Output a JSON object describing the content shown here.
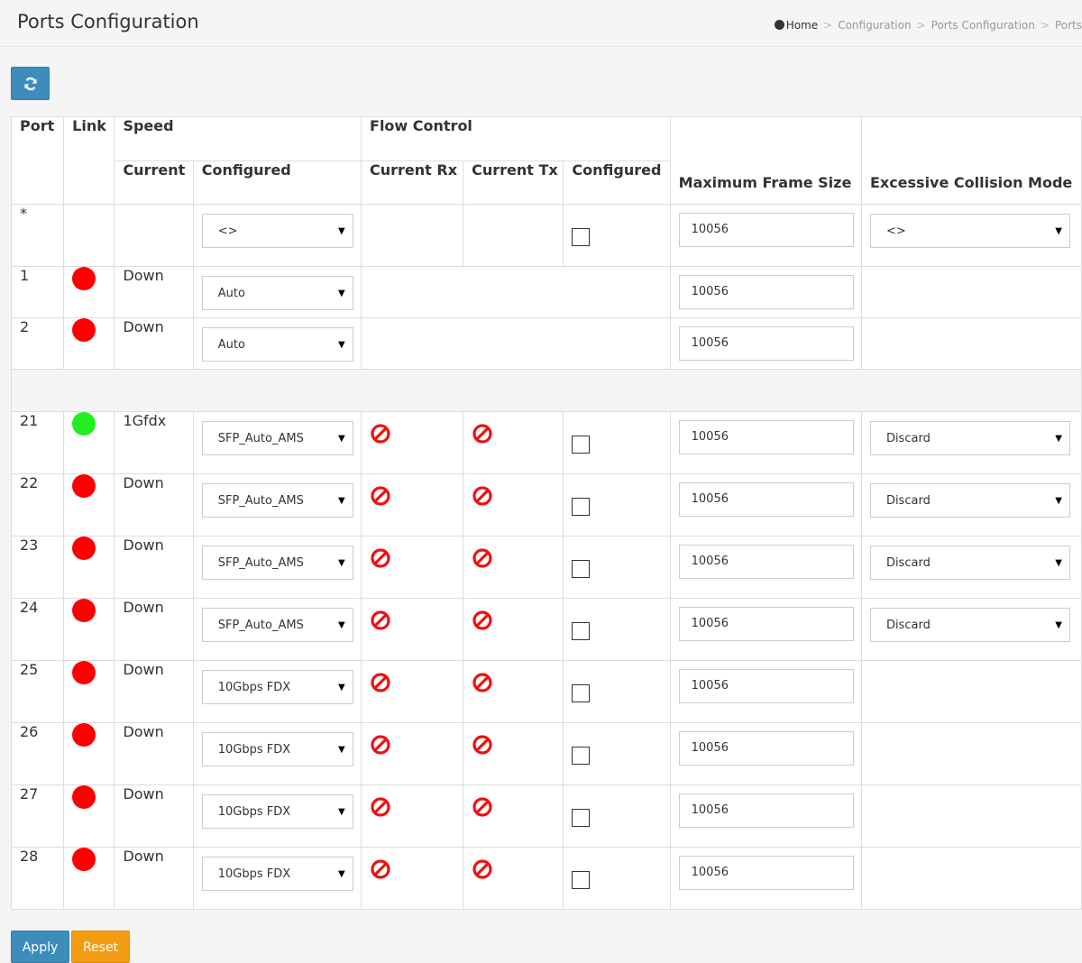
{
  "page": {
    "title": "Ports Configuration"
  },
  "breadcrumb": {
    "home": "Home",
    "items": [
      "Configuration",
      "Ports Configuration",
      "Ports"
    ],
    "separator": ">"
  },
  "toolbar": {
    "refresh_icon": "refresh-icon"
  },
  "table": {
    "headers": {
      "port": "Port",
      "link": "Link",
      "speed_group": "Speed",
      "speed_current": "Current",
      "speed_configured": "Configured",
      "flow_group": "Flow Control",
      "flow_current_rx": "Current Rx",
      "flow_current_tx": "Current Tx",
      "flow_configured": "Configured",
      "max_frame": "Maximum Frame Size",
      "ecm": "Excessive Collision Mode"
    },
    "star_row": {
      "port": "*",
      "speed_configured": "<>",
      "max_frame": "10056",
      "ecm": "<>"
    },
    "rows": [
      {
        "port": "1",
        "link": "down",
        "current": "Down",
        "speed_configured": "Auto",
        "max_frame": "10056",
        "show_flow": false,
        "ecm": ""
      },
      {
        "port": "2",
        "link": "down",
        "current": "Down",
        "speed_configured": "Auto",
        "max_frame": "10056",
        "show_flow": false,
        "ecm": ""
      },
      {
        "port": "21",
        "link": "up",
        "current": "1Gfdx",
        "speed_configured": "SFP_Auto_AMS",
        "max_frame": "10056",
        "show_flow": true,
        "ecm": "Discard"
      },
      {
        "port": "22",
        "link": "down",
        "current": "Down",
        "speed_configured": "SFP_Auto_AMS",
        "max_frame": "10056",
        "show_flow": true,
        "ecm": "Discard"
      },
      {
        "port": "23",
        "link": "down",
        "current": "Down",
        "speed_configured": "SFP_Auto_AMS",
        "max_frame": "10056",
        "show_flow": true,
        "ecm": "Discard"
      },
      {
        "port": "24",
        "link": "down",
        "current": "Down",
        "speed_configured": "SFP_Auto_AMS",
        "max_frame": "10056",
        "show_flow": true,
        "ecm": "Discard"
      },
      {
        "port": "25",
        "link": "down",
        "current": "Down",
        "speed_configured": "10Gbps FDX",
        "max_frame": "10056",
        "show_flow": true,
        "ecm": ""
      },
      {
        "port": "26",
        "link": "down",
        "current": "Down",
        "speed_configured": "10Gbps FDX",
        "max_frame": "10056",
        "show_flow": true,
        "ecm": ""
      },
      {
        "port": "27",
        "link": "down",
        "current": "Down",
        "speed_configured": "10Gbps FDX",
        "max_frame": "10056",
        "show_flow": true,
        "ecm": ""
      },
      {
        "port": "28",
        "link": "down",
        "current": "Down",
        "speed_configured": "10Gbps FDX",
        "max_frame": "10056",
        "show_flow": true,
        "ecm": ""
      }
    ],
    "flow_icon": "prohibited-icon",
    "link_up_color": "#22ee22",
    "link_down_color": "#ff0000"
  },
  "actions": {
    "apply": "Apply",
    "reset": "Reset"
  },
  "colors": {
    "primary": "#3c8dbc",
    "warning": "#f39c12",
    "prohibited": "#ee1111"
  }
}
